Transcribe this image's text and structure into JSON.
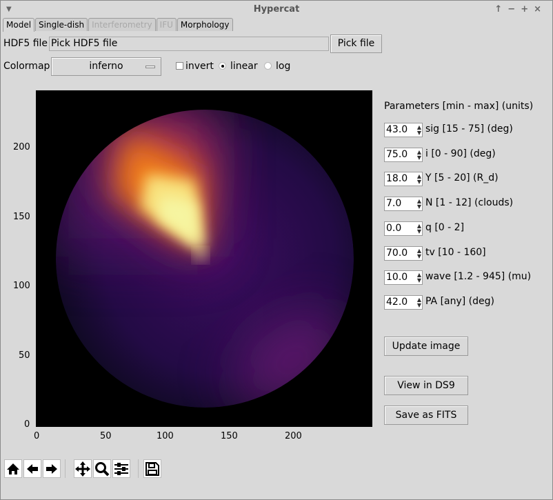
{
  "window": {
    "title": "Hypercat",
    "menu_icon": "triangle-down-icon",
    "buttons": [
      "↑",
      "−",
      "+",
      "×"
    ]
  },
  "tabs": [
    {
      "label": "Model",
      "active": true
    },
    {
      "label": "Single-dish"
    },
    {
      "label": "Interferometry",
      "disabled": true
    },
    {
      "label": "IFU",
      "disabled": true
    },
    {
      "label": "Morphology"
    }
  ],
  "file": {
    "label": "HDF5 file",
    "value": "Pick HDF5 file",
    "button": "Pick file"
  },
  "colormap": {
    "label": "Colormap",
    "value": "inferno",
    "invert_label": "invert",
    "invert": false,
    "scale_options": [
      "linear",
      "log"
    ],
    "scale": "linear"
  },
  "parameters": {
    "header": "Parameters [min - max] (units)",
    "items": [
      {
        "value": "43.0",
        "label": "sig [15 - 75] (deg)"
      },
      {
        "value": "75.0",
        "label": "i [0 - 90] (deg)"
      },
      {
        "value": "18.0",
        "label": "Y [5 - 20] (R_d)"
      },
      {
        "value": "7.0",
        "label": "N [1 - 12] (clouds)"
      },
      {
        "value": "0.0",
        "label": "q [0 - 2]"
      },
      {
        "value": "70.0",
        "label": "tv [10 - 160]"
      },
      {
        "value": "10.0",
        "label": "wave [1.2 - 945] (mu)"
      },
      {
        "value": "42.0",
        "label": "PA [any] (deg)"
      }
    ]
  },
  "actions": {
    "update": "Update image",
    "ds9": "View in DS9",
    "fits": "Save as FITS"
  },
  "plot": {
    "colormap": "inferno",
    "xticks": [
      "0",
      "50",
      "100",
      "150",
      "200"
    ],
    "yticks": [
      "0",
      "50",
      "100",
      "150",
      "200"
    ]
  },
  "toolbar": [
    "home-icon",
    "back-icon",
    "forward-icon",
    "pan-icon",
    "zoom-icon",
    "configure-icon",
    "save-icon"
  ]
}
